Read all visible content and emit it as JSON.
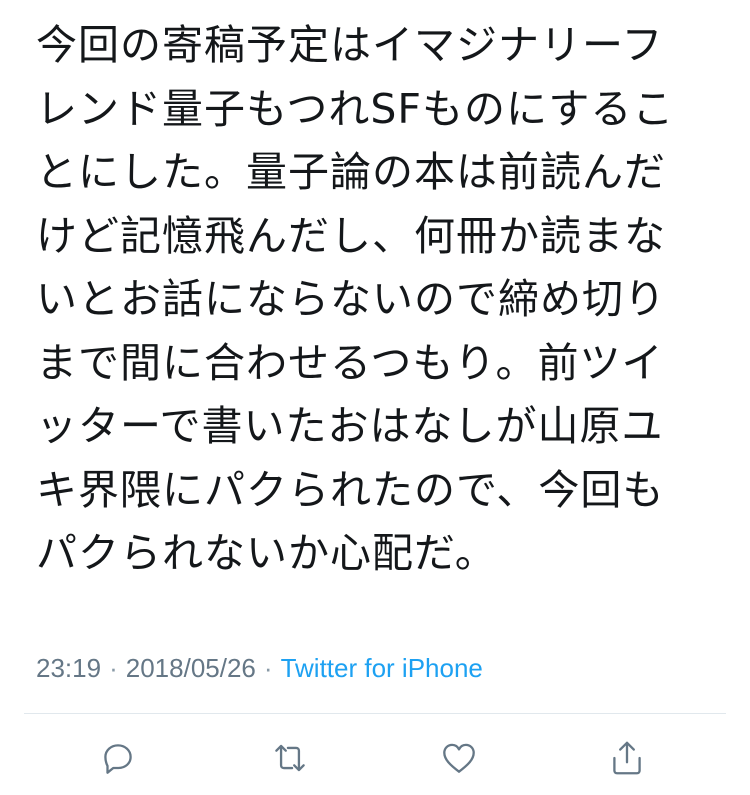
{
  "tweet": {
    "lines": [
      "今回の寄稿予定はイマジナリーフ",
      "レンド量子もつれSFものにするこ",
      "とにした。量子論の本は前読んだ",
      "けど記憶飛んだし、何冊か読まな",
      "いとお話にならないので締め切り",
      "まで間に合わせるつもり。前ツイ",
      "ッターで書いたおはなしが山原ユ",
      "キ界隈にパクられたので、今回も",
      "パクられないか心配だ。"
    ]
  },
  "meta": {
    "time": "23:19",
    "separator": "·",
    "date": "2018/05/26",
    "source": "Twitter for iPhone"
  },
  "actions": {
    "reply_icon": "reply-icon",
    "retweet_icon": "retweet-icon",
    "like_icon": "heart-icon",
    "share_icon": "share-icon"
  },
  "colors": {
    "text": "#14171a",
    "meta": "#657786",
    "link": "#1da1f2",
    "divider": "#e1e8ed",
    "icon": "#657786"
  }
}
